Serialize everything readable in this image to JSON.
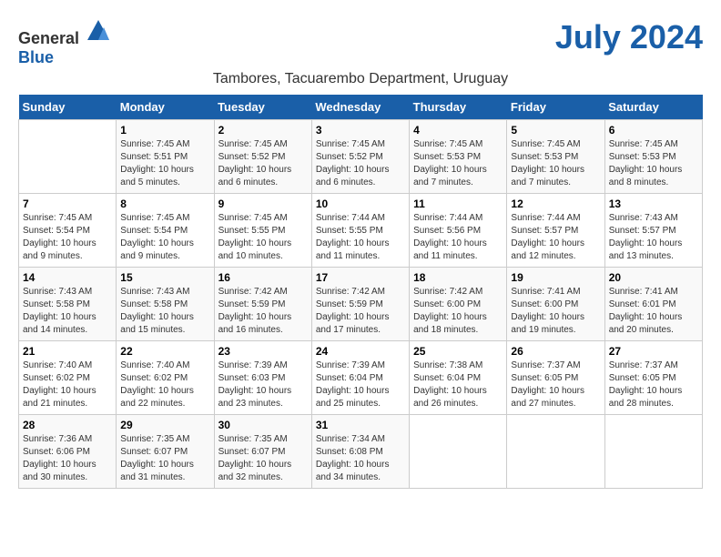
{
  "logo": {
    "general": "General",
    "blue": "Blue"
  },
  "title": "July 2024",
  "location": "Tambores, Tacuarembo Department, Uruguay",
  "days_of_week": [
    "Sunday",
    "Monday",
    "Tuesday",
    "Wednesday",
    "Thursday",
    "Friday",
    "Saturday"
  ],
  "weeks": [
    [
      {
        "day": "",
        "info": ""
      },
      {
        "day": "1",
        "info": "Sunrise: 7:45 AM\nSunset: 5:51 PM\nDaylight: 10 hours\nand 5 minutes."
      },
      {
        "day": "2",
        "info": "Sunrise: 7:45 AM\nSunset: 5:52 PM\nDaylight: 10 hours\nand 6 minutes."
      },
      {
        "day": "3",
        "info": "Sunrise: 7:45 AM\nSunset: 5:52 PM\nDaylight: 10 hours\nand 6 minutes."
      },
      {
        "day": "4",
        "info": "Sunrise: 7:45 AM\nSunset: 5:53 PM\nDaylight: 10 hours\nand 7 minutes."
      },
      {
        "day": "5",
        "info": "Sunrise: 7:45 AM\nSunset: 5:53 PM\nDaylight: 10 hours\nand 7 minutes."
      },
      {
        "day": "6",
        "info": "Sunrise: 7:45 AM\nSunset: 5:53 PM\nDaylight: 10 hours\nand 8 minutes."
      }
    ],
    [
      {
        "day": "7",
        "info": "Sunrise: 7:45 AM\nSunset: 5:54 PM\nDaylight: 10 hours\nand 9 minutes."
      },
      {
        "day": "8",
        "info": "Sunrise: 7:45 AM\nSunset: 5:54 PM\nDaylight: 10 hours\nand 9 minutes."
      },
      {
        "day": "9",
        "info": "Sunrise: 7:45 AM\nSunset: 5:55 PM\nDaylight: 10 hours\nand 10 minutes."
      },
      {
        "day": "10",
        "info": "Sunrise: 7:44 AM\nSunset: 5:55 PM\nDaylight: 10 hours\nand 11 minutes."
      },
      {
        "day": "11",
        "info": "Sunrise: 7:44 AM\nSunset: 5:56 PM\nDaylight: 10 hours\nand 11 minutes."
      },
      {
        "day": "12",
        "info": "Sunrise: 7:44 AM\nSunset: 5:57 PM\nDaylight: 10 hours\nand 12 minutes."
      },
      {
        "day": "13",
        "info": "Sunrise: 7:43 AM\nSunset: 5:57 PM\nDaylight: 10 hours\nand 13 minutes."
      }
    ],
    [
      {
        "day": "14",
        "info": "Sunrise: 7:43 AM\nSunset: 5:58 PM\nDaylight: 10 hours\nand 14 minutes."
      },
      {
        "day": "15",
        "info": "Sunrise: 7:43 AM\nSunset: 5:58 PM\nDaylight: 10 hours\nand 15 minutes."
      },
      {
        "day": "16",
        "info": "Sunrise: 7:42 AM\nSunset: 5:59 PM\nDaylight: 10 hours\nand 16 minutes."
      },
      {
        "day": "17",
        "info": "Sunrise: 7:42 AM\nSunset: 5:59 PM\nDaylight: 10 hours\nand 17 minutes."
      },
      {
        "day": "18",
        "info": "Sunrise: 7:42 AM\nSunset: 6:00 PM\nDaylight: 10 hours\nand 18 minutes."
      },
      {
        "day": "19",
        "info": "Sunrise: 7:41 AM\nSunset: 6:00 PM\nDaylight: 10 hours\nand 19 minutes."
      },
      {
        "day": "20",
        "info": "Sunrise: 7:41 AM\nSunset: 6:01 PM\nDaylight: 10 hours\nand 20 minutes."
      }
    ],
    [
      {
        "day": "21",
        "info": "Sunrise: 7:40 AM\nSunset: 6:02 PM\nDaylight: 10 hours\nand 21 minutes."
      },
      {
        "day": "22",
        "info": "Sunrise: 7:40 AM\nSunset: 6:02 PM\nDaylight: 10 hours\nand 22 minutes."
      },
      {
        "day": "23",
        "info": "Sunrise: 7:39 AM\nSunset: 6:03 PM\nDaylight: 10 hours\nand 23 minutes."
      },
      {
        "day": "24",
        "info": "Sunrise: 7:39 AM\nSunset: 6:04 PM\nDaylight: 10 hours\nand 25 minutes."
      },
      {
        "day": "25",
        "info": "Sunrise: 7:38 AM\nSunset: 6:04 PM\nDaylight: 10 hours\nand 26 minutes."
      },
      {
        "day": "26",
        "info": "Sunrise: 7:37 AM\nSunset: 6:05 PM\nDaylight: 10 hours\nand 27 minutes."
      },
      {
        "day": "27",
        "info": "Sunrise: 7:37 AM\nSunset: 6:05 PM\nDaylight: 10 hours\nand 28 minutes."
      }
    ],
    [
      {
        "day": "28",
        "info": "Sunrise: 7:36 AM\nSunset: 6:06 PM\nDaylight: 10 hours\nand 30 minutes."
      },
      {
        "day": "29",
        "info": "Sunrise: 7:35 AM\nSunset: 6:07 PM\nDaylight: 10 hours\nand 31 minutes."
      },
      {
        "day": "30",
        "info": "Sunrise: 7:35 AM\nSunset: 6:07 PM\nDaylight: 10 hours\nand 32 minutes."
      },
      {
        "day": "31",
        "info": "Sunrise: 7:34 AM\nSunset: 6:08 PM\nDaylight: 10 hours\nand 34 minutes."
      },
      {
        "day": "",
        "info": ""
      },
      {
        "day": "",
        "info": ""
      },
      {
        "day": "",
        "info": ""
      }
    ]
  ]
}
